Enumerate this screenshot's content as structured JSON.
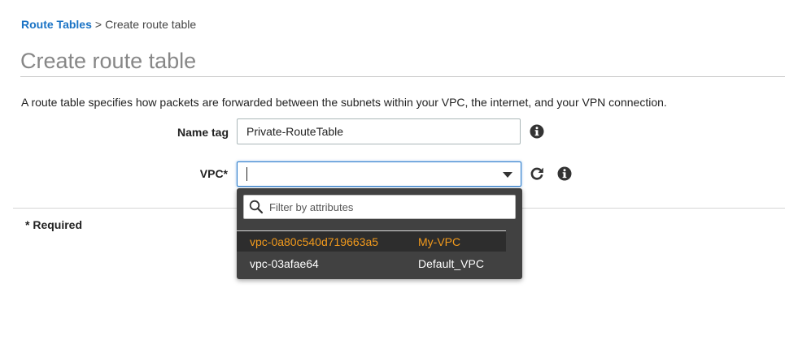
{
  "breadcrumb": {
    "parent": "Route Tables",
    "separator": ">",
    "current": "Create route table"
  },
  "page": {
    "title": "Create route table",
    "description": "A route table specifies how packets are forwarded between the subnets within your VPC, the internet, and your VPN connection."
  },
  "form": {
    "name_tag": {
      "label": "Name tag",
      "value": "Private-RouteTable"
    },
    "vpc": {
      "label": "VPC*",
      "value": ""
    },
    "required_note": "* Required"
  },
  "dropdown": {
    "filter_placeholder": "Filter by attributes",
    "options": [
      {
        "id": "vpc-0a80c540d719663a5",
        "name": "My-VPC",
        "highlighted": true
      },
      {
        "id": "vpc-03afae64",
        "name": "Default_VPC",
        "highlighted": false
      }
    ]
  },
  "colors": {
    "link": "#1a73c5",
    "highlight_text": "#f29a1c",
    "dropdown_bg": "#414141",
    "focus_border": "#2b7bcc"
  },
  "icons": [
    "info-icon",
    "refresh-icon",
    "search-icon",
    "chevron-down-icon"
  ]
}
